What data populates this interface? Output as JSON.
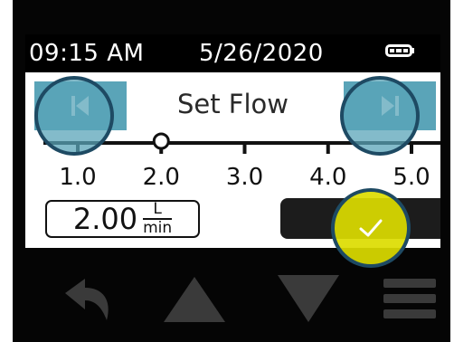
{
  "status": {
    "time": "09:15 AM",
    "date": "5/26/2020",
    "battery_icon": "battery-full-icon"
  },
  "header": {
    "title": "Set Flow",
    "prev_icon": "skip-previous-icon",
    "next_icon": "skip-next-icon"
  },
  "slider": {
    "ticks": [
      "1.0",
      "2.0",
      "3.0",
      "4.0",
      "5.0"
    ],
    "tick_values": [
      1.0,
      2.0,
      3.0,
      4.0,
      5.0
    ],
    "min": 1.0,
    "max": 5.0,
    "current": 2.0
  },
  "flow_value": {
    "value": "2.00",
    "unit_numerator": "L",
    "unit_denominator": "min"
  },
  "confirm": {
    "icon": "checkmark-icon"
  },
  "bottom_nav": {
    "back_icon": "back-arrow-icon",
    "up_icon": "up-arrow-icon",
    "down_icon": "down-arrow-icon",
    "menu_icon": "menu-icon"
  },
  "colors": {
    "nav_button": "#5aa4b8",
    "confirm_highlight": "#dcdc00",
    "highlight_ring": "#1e4a63",
    "bottom_icons": "#3a3a3a",
    "confirm_button": "#1c1c1c"
  }
}
